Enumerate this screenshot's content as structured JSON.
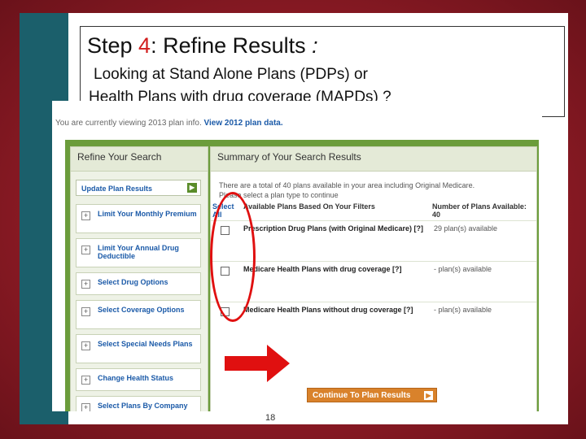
{
  "slide": {
    "title_prefix": "Step ",
    "title_num": "4",
    "title_main": ": Refine Results ",
    "title_colon": ":",
    "subtitle_line1": "Looking at Stand Alone Plans (PDPs) or",
    "subtitle_line2": "Health Plans with drug coverage (MAPDs) ?",
    "page_number": "18",
    "accent_color": "#d21e1e"
  },
  "screenshot": {
    "top_text": "You are currently viewing 2013 plan info.",
    "top_link": "View 2012 plan data.",
    "refine": {
      "header": "Refine Your Search",
      "update_button": "Update Plan Results",
      "items": [
        "Limit Your Monthly Premium",
        "Limit Your Annual Drug Deductible",
        "Select Drug Options",
        "Select Coverage Options",
        "Select Special Needs Plans",
        "Change Health Status",
        "Select Plans By Company"
      ]
    },
    "summary": {
      "header": "Summary of Your Search Results",
      "intro_line1": "There are a total of 40 plans available in your area including Original Medicare.",
      "intro_line2": "Please select a plan type to continue",
      "col_select": "Select All",
      "col_plans": "Available Plans Based On Your Filters",
      "col_count": "Number of Plans Available: 40",
      "rows": [
        {
          "label": "Prescription Drug Plans (with Original Medicare) [?]",
          "count": "29 plan(s) available"
        },
        {
          "label": "Medicare Health Plans with drug coverage [?]",
          "count": "- plan(s) available"
        },
        {
          "label": "Medicare Health Plans without drug coverage [?]",
          "count": "- plan(s) available"
        }
      ],
      "continue_button": "Continue To Plan Results"
    }
  }
}
